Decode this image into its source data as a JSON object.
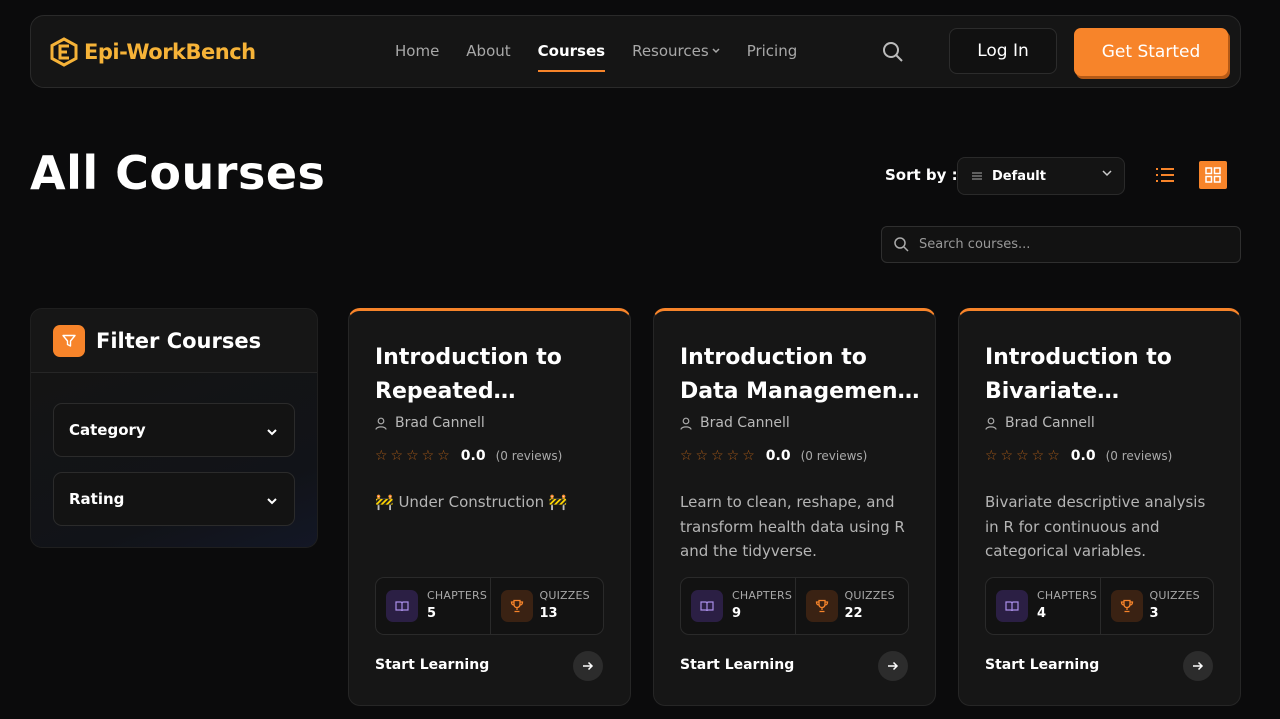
{
  "brand": {
    "name": "Epi-WorkBench",
    "accent": "#f7842a",
    "logo_color": "#f6b338"
  },
  "nav": {
    "items": [
      {
        "label": "Home",
        "active": false
      },
      {
        "label": "About",
        "active": false
      },
      {
        "label": "Courses",
        "active": true
      },
      {
        "label": "Resources",
        "active": false,
        "dropdown": true
      },
      {
        "label": "Pricing",
        "active": false
      }
    ],
    "login_label": "Log In",
    "cta_label": "Get Started"
  },
  "page": {
    "title": "All Courses"
  },
  "sort": {
    "label": "Sort by :",
    "value": "Default"
  },
  "search": {
    "placeholder": "Search courses..."
  },
  "filters": {
    "title": "Filter Courses",
    "groups": [
      {
        "label": "Category"
      },
      {
        "label": "Rating"
      }
    ]
  },
  "courses": [
    {
      "title": "Introduction to Repeated…",
      "author": "Brad Cannell",
      "rating": "0.0",
      "reviews": "(0 reviews)",
      "description": "🚧 Under Construction 🚧",
      "chapters_label": "CHAPTERS",
      "chapters": "5",
      "quizzes_label": "QUIZZES",
      "quizzes": "13",
      "cta": "Start Learning"
    },
    {
      "title": "Introduction to Data Managemen…",
      "author": "Brad Cannell",
      "rating": "0.0",
      "reviews": "(0 reviews)",
      "description": "Learn to clean, reshape, and transform health data using R and the tidyverse.",
      "chapters_label": "CHAPTERS",
      "chapters": "9",
      "quizzes_label": "QUIZZES",
      "quizzes": "22",
      "cta": "Start Learning"
    },
    {
      "title": "Introduction to Bivariate…",
      "author": "Brad Cannell",
      "rating": "0.0",
      "reviews": "(0 reviews)",
      "description": "Bivariate descriptive analysis in R for continuous and categorical variables.",
      "chapters_label": "CHAPTERS",
      "chapters": "4",
      "quizzes_label": "QUIZZES",
      "quizzes": "3",
      "cta": "Start Learning"
    }
  ]
}
